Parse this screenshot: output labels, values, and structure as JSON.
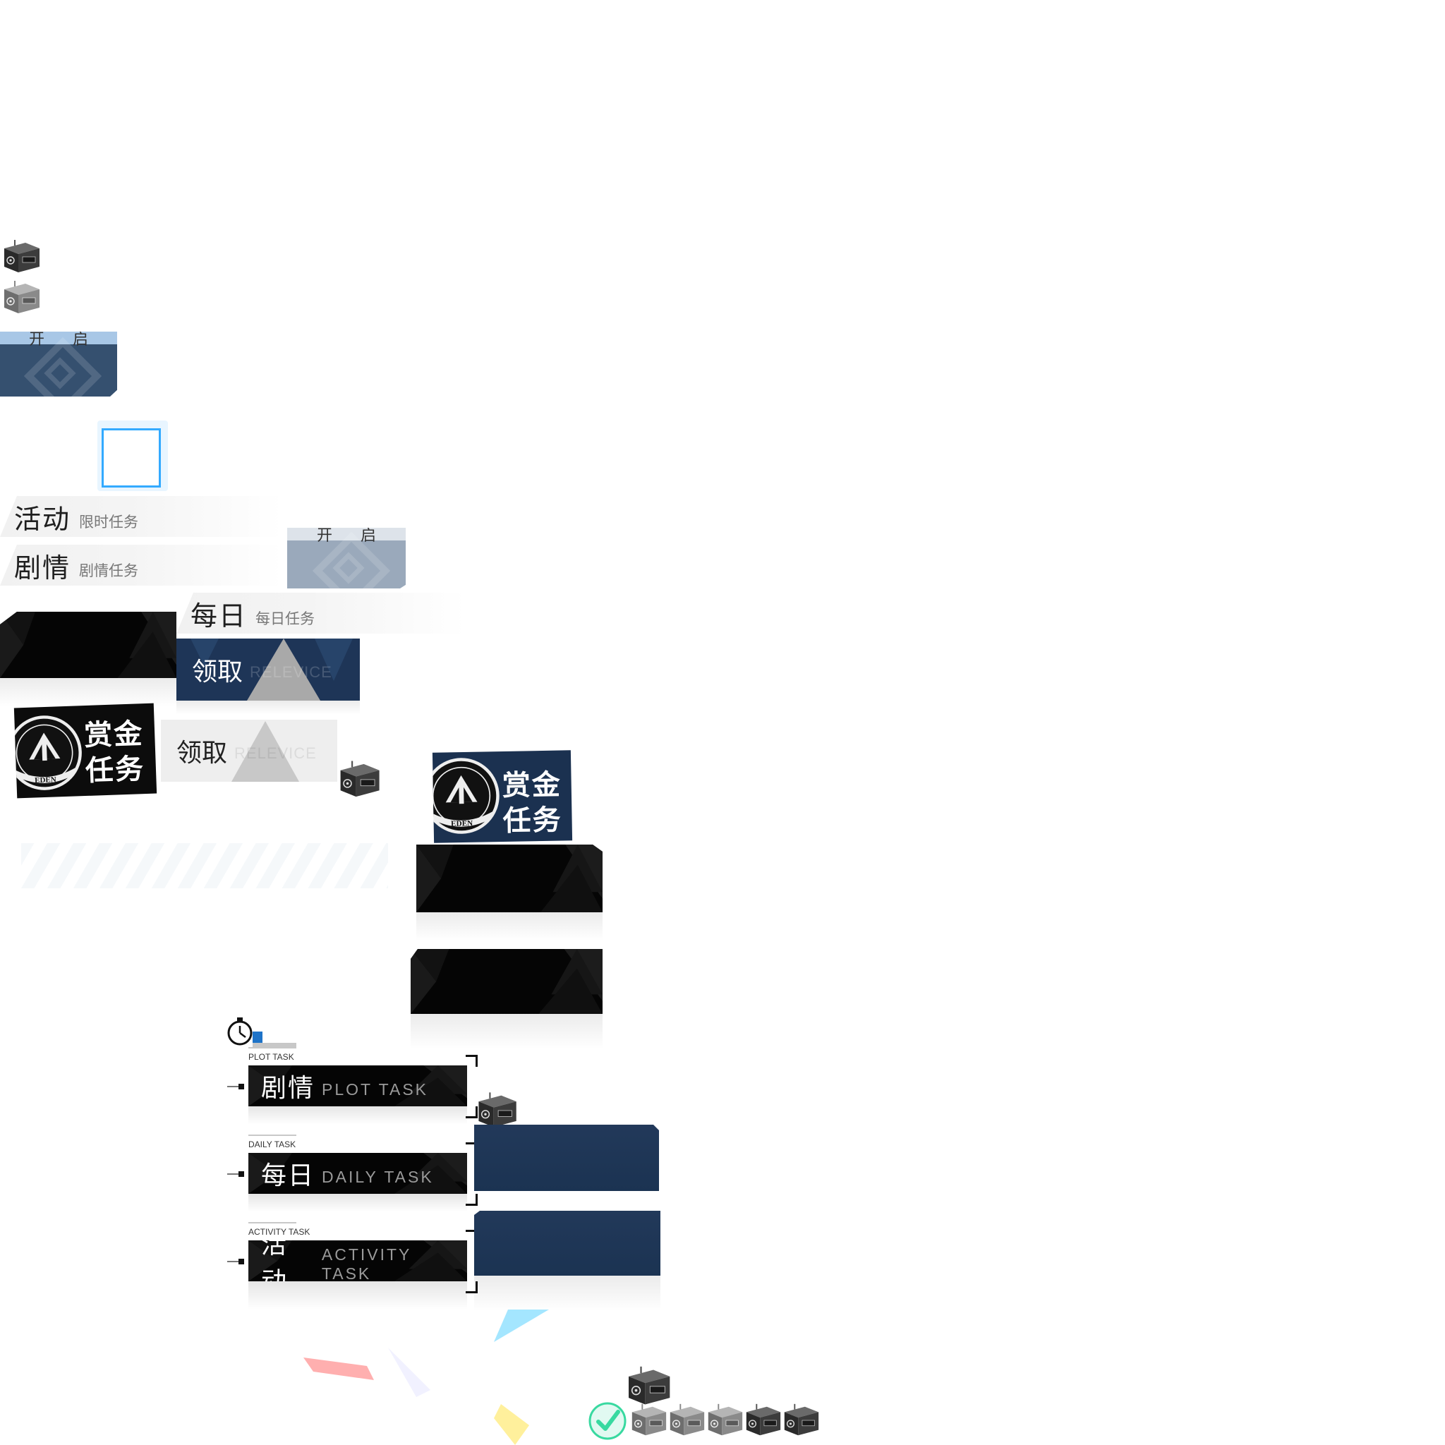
{
  "open_button": {
    "left_char": "开",
    "right_char": "启"
  },
  "tabs": {
    "activity": {
      "title": "活动",
      "subtitle": "限时任务"
    },
    "plot": {
      "title": "剧情",
      "subtitle": "剧情任务"
    },
    "daily": {
      "title": "每日",
      "subtitle": "每日任务"
    }
  },
  "claim": {
    "label": "领取",
    "watermark": "RELEVICE"
  },
  "bounty": {
    "line1": "赏金",
    "line2": "任务",
    "emblem_text": "EDEN"
  },
  "task_list": [
    {
      "caption": "PLOT TASK",
      "title": "剧情",
      "en": "PLOT TASK"
    },
    {
      "caption": "DAILY TASK",
      "title": "每日",
      "en": "DAILY TASK"
    },
    {
      "caption": "ACTIVITY TASK",
      "title": "活动",
      "en": "ACTIVITY TASK"
    }
  ],
  "colors": {
    "navy": "#1e3557",
    "navy_light": "#35506f",
    "open_bar_blue": "#a8c7e6",
    "frame_blue": "#33aaff",
    "claim_disabled_bg": "#eeeeee",
    "check_green": "#38d9a0"
  },
  "icons": {
    "box": "treasure-box-icon",
    "clock": "clock-icon",
    "check": "check-icon",
    "emblem": "eden-emblem-icon"
  }
}
